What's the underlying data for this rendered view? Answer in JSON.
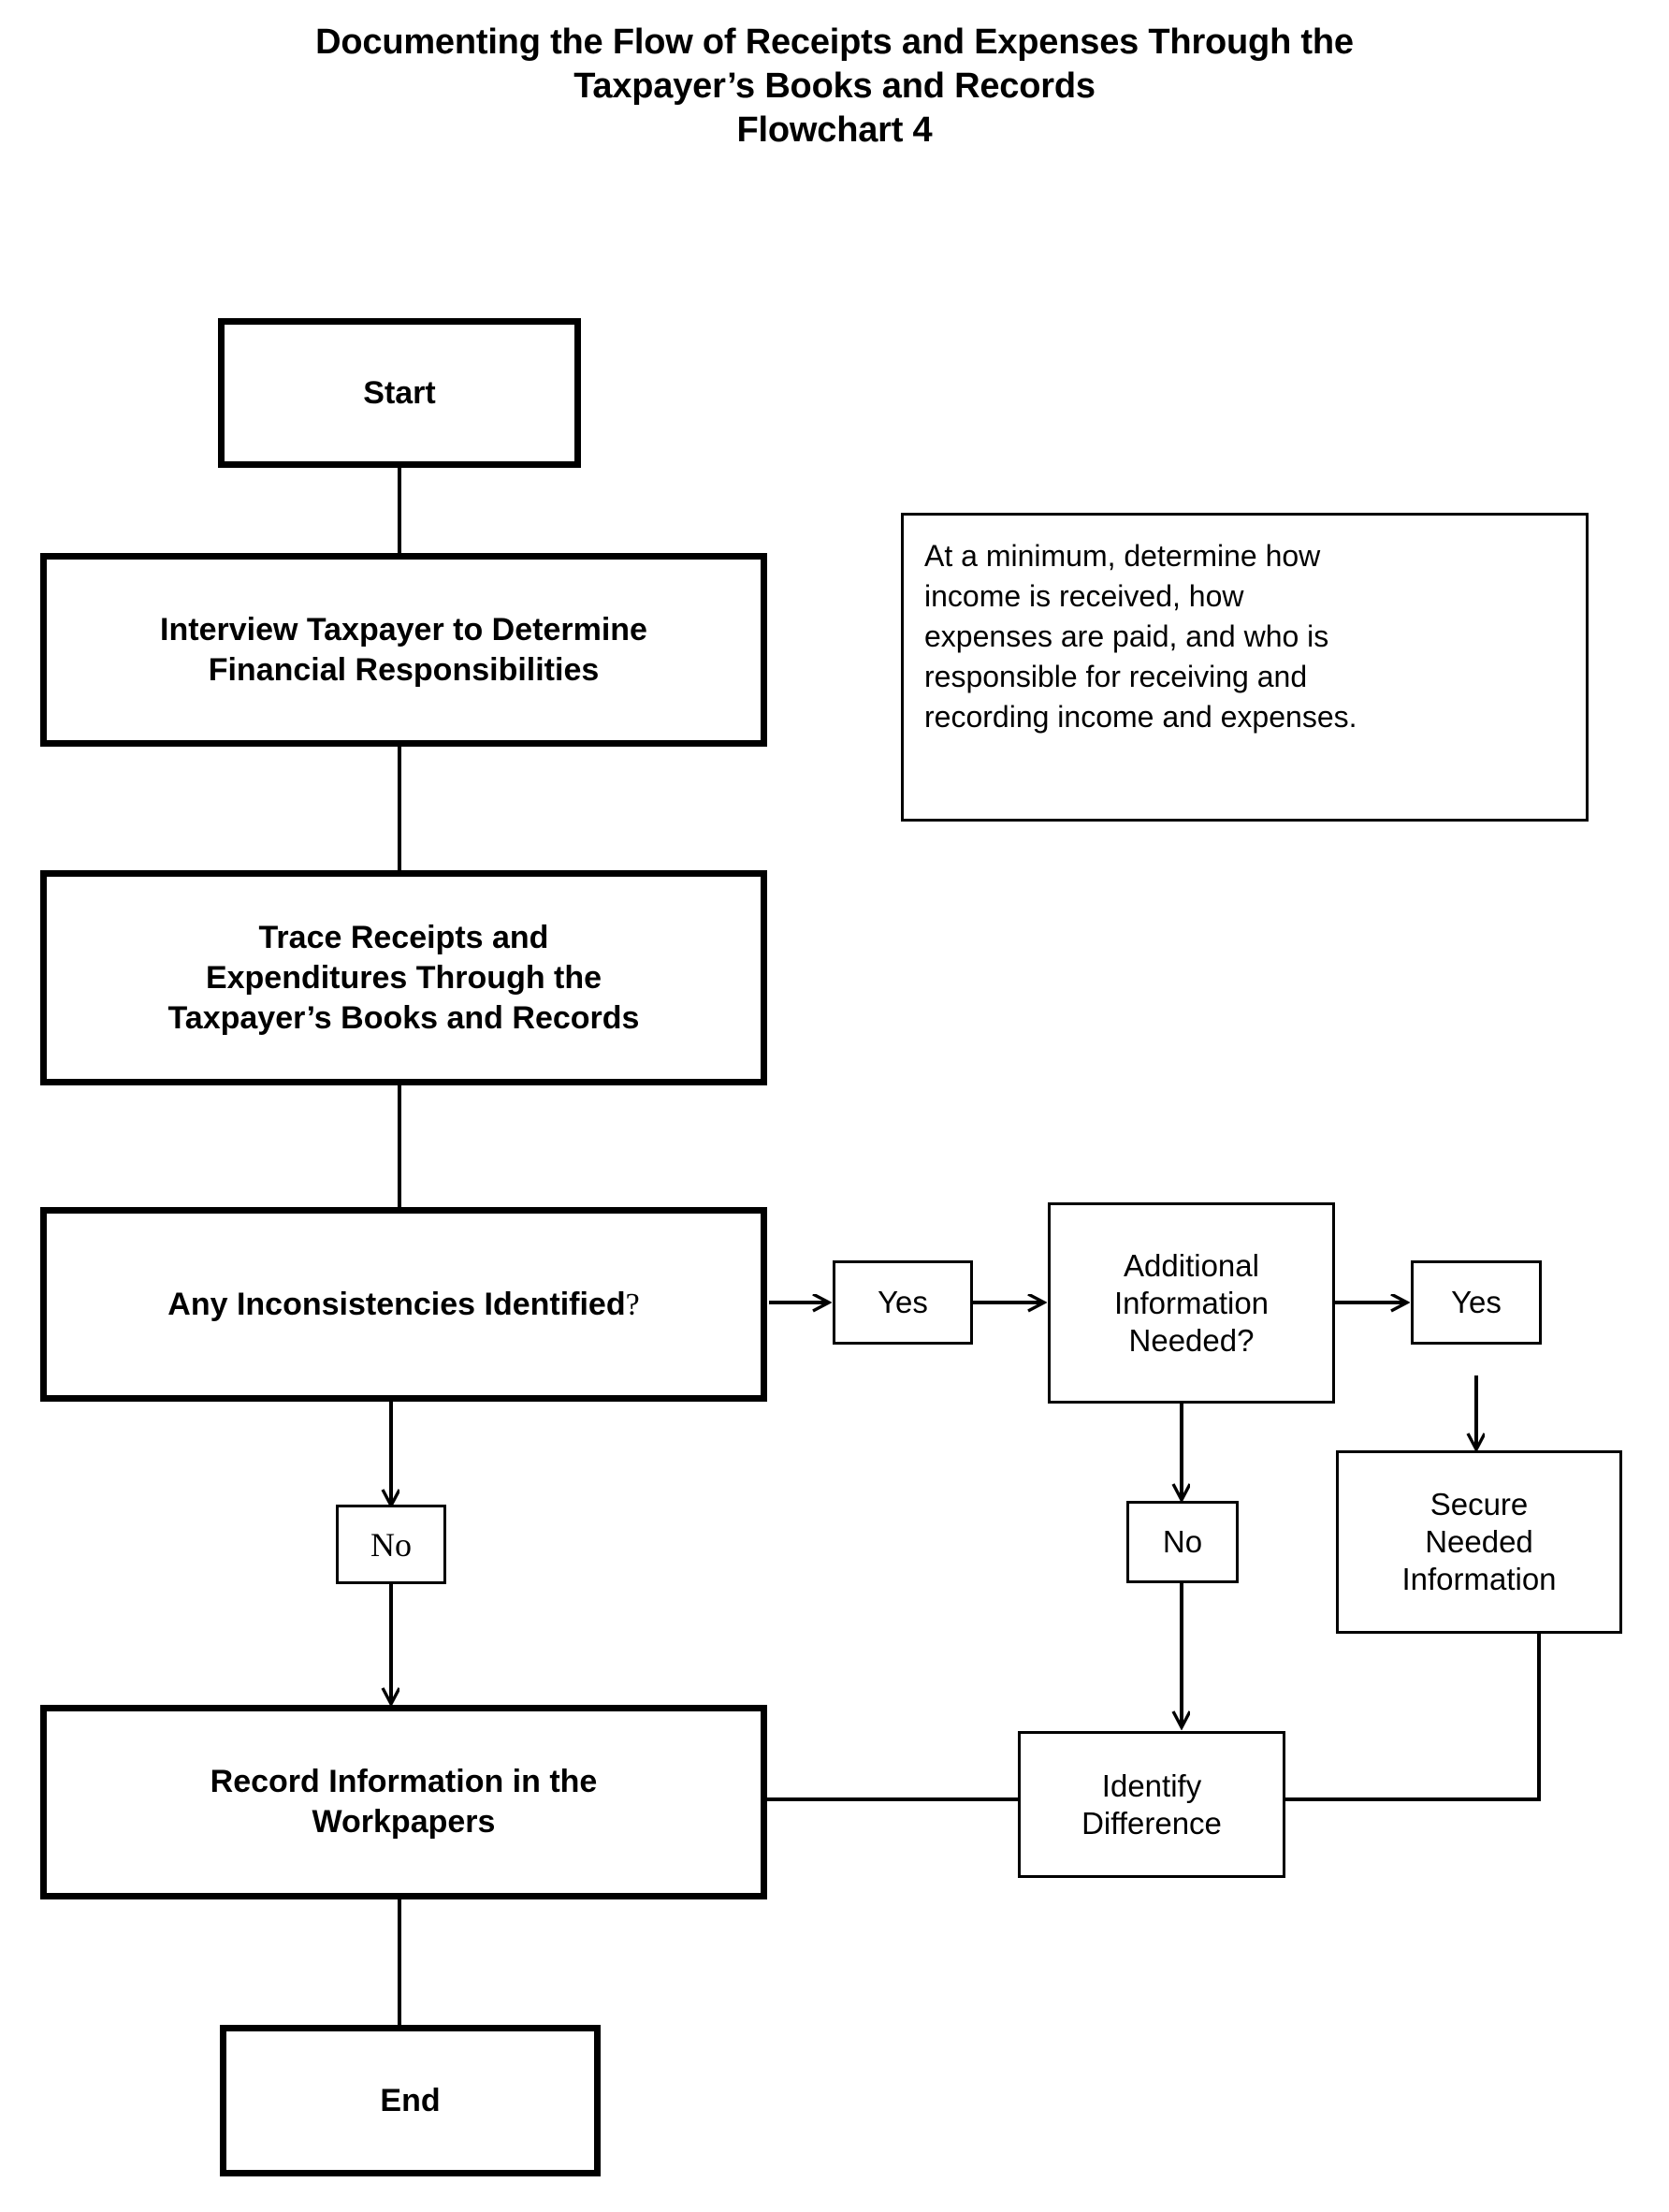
{
  "title": {
    "line1": "Documenting the Flow of Receipts and Expenses Through the",
    "line2": "Taxpayer’s Books and Records",
    "line3": "Flowchart 4"
  },
  "colors": {
    "stroke": "#000000",
    "fill": "#ffffff",
    "text": "#000000"
  },
  "nodes": {
    "start": {
      "label": "Start"
    },
    "interview": {
      "line1": "Interview Taxpayer to Determine",
      "line2": "Financial Responsibilities"
    },
    "note": {
      "line1": "At a minimum, determine how",
      "line2": "income is received, how",
      "line3": "expenses are paid, and who is",
      "line4": "responsible for receiving and",
      "line5": "recording income and expenses."
    },
    "trace": {
      "line1": "Trace Receipts and",
      "line2": "Expenditures Through the",
      "line3": "Taxpayer’s Books and Records"
    },
    "decision_inconsistencies": {
      "text": "Any Inconsistencies Identified",
      "mark": "?"
    },
    "yes_1": {
      "label": "Yes"
    },
    "decision_additional_info": {
      "line1": "Additional",
      "line2": "Information",
      "line3": "Needed?"
    },
    "yes_2": {
      "label": "Yes"
    },
    "no_left": {
      "label": "No"
    },
    "no_right": {
      "label": "No"
    },
    "secure_info": {
      "line1": "Secure",
      "line2": "Needed",
      "line3": "Information"
    },
    "identify_difference": {
      "line1": "Identify",
      "line2": "Difference"
    },
    "record_info": {
      "line1": "Record Information in the",
      "line2": "Workpapers"
    },
    "end": {
      "label": "End"
    }
  },
  "edges": [
    {
      "name": "start-to-interview",
      "from": "start",
      "to": "interview",
      "label": ""
    },
    {
      "name": "interview-to-trace",
      "from": "interview",
      "to": "trace",
      "label": ""
    },
    {
      "name": "trace-to-decision",
      "from": "trace",
      "to": "decision_inconsistencies",
      "label": ""
    },
    {
      "name": "decision-to-yes1",
      "from": "decision_inconsistencies",
      "to": "yes_1",
      "label": "Yes"
    },
    {
      "name": "yes1-to-additional",
      "from": "yes_1",
      "to": "decision_additional_info",
      "label": ""
    },
    {
      "name": "additional-to-yes2",
      "from": "decision_additional_info",
      "to": "yes_2",
      "label": "Yes"
    },
    {
      "name": "additional-to-no",
      "from": "decision_additional_info",
      "to": "no_right",
      "label": "No"
    },
    {
      "name": "yes2-to-secure",
      "from": "yes_2",
      "to": "secure_info",
      "label": ""
    },
    {
      "name": "no-right-to-identify",
      "from": "no_right",
      "to": "identify_difference",
      "label": ""
    },
    {
      "name": "secure-to-identify",
      "from": "secure_info",
      "to": "identify_difference",
      "label": ""
    },
    {
      "name": "identify-to-record",
      "from": "identify_difference",
      "to": "record_info",
      "label": ""
    },
    {
      "name": "decision-to-no-left",
      "from": "decision_inconsistencies",
      "to": "no_left",
      "label": "No"
    },
    {
      "name": "no-left-to-record",
      "from": "no_left",
      "to": "record_info",
      "label": ""
    },
    {
      "name": "record-to-end",
      "from": "record_info",
      "to": "end",
      "label": ""
    }
  ]
}
